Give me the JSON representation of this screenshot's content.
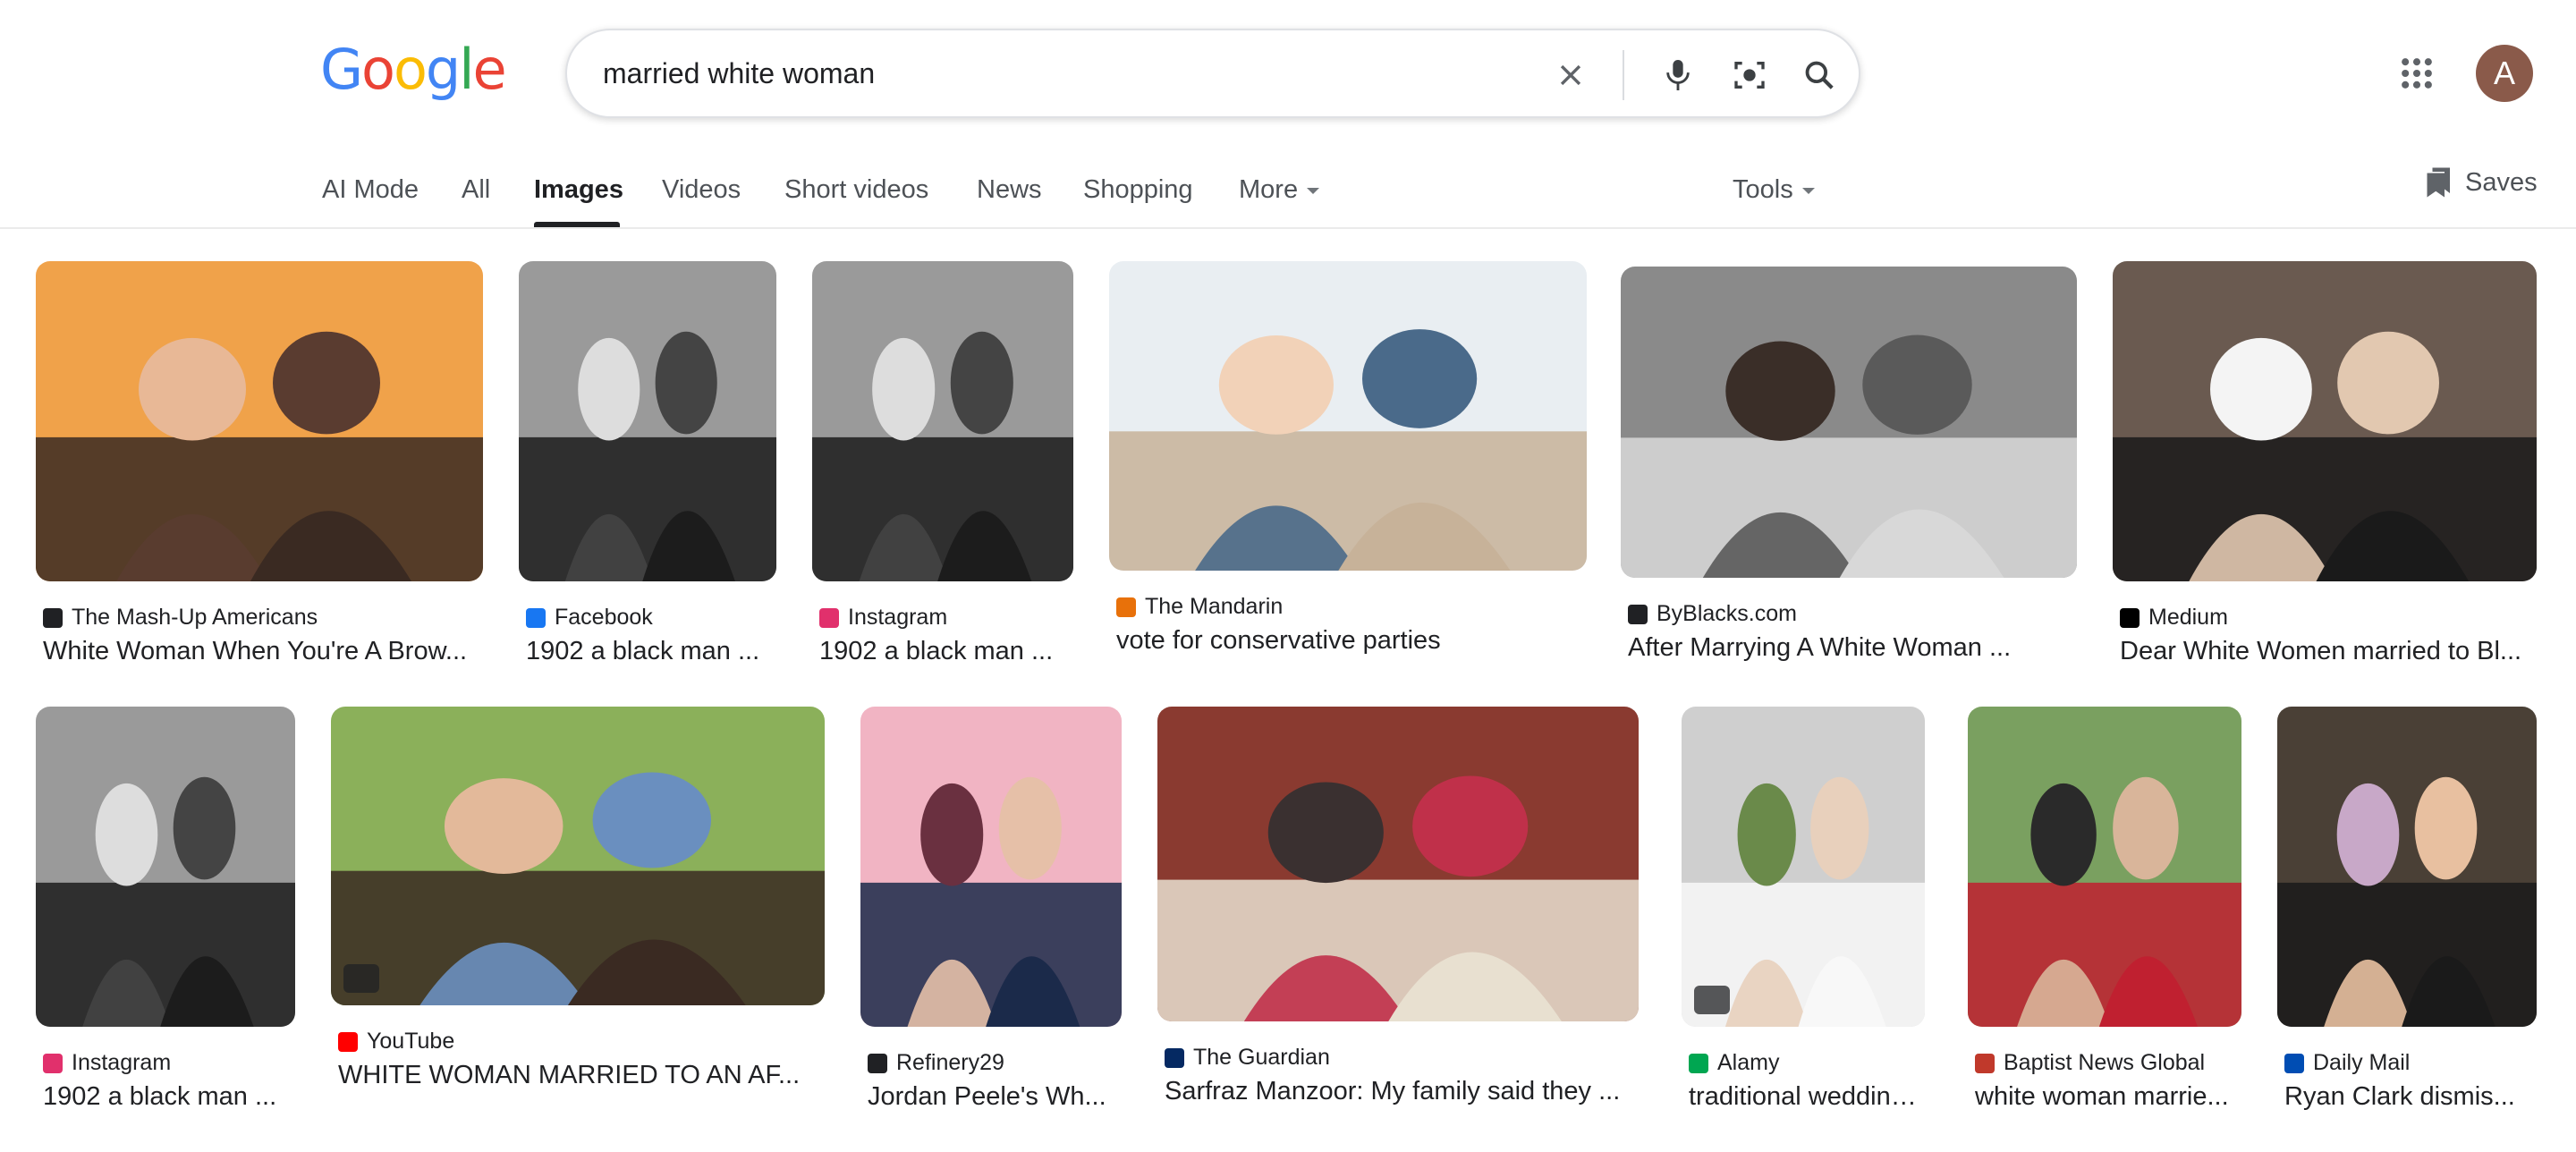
{
  "header": {
    "logo_letters": [
      {
        "ch": "G",
        "color": "#4285f4"
      },
      {
        "ch": "o",
        "color": "#ea4335"
      },
      {
        "ch": "o",
        "color": "#fbbc05"
      },
      {
        "ch": "g",
        "color": "#4285f4"
      },
      {
        "ch": "l",
        "color": "#34a853"
      },
      {
        "ch": "e",
        "color": "#ea4335"
      }
    ],
    "search_query": "married white woman",
    "avatar_letter": "A"
  },
  "nav": {
    "tabs": [
      {
        "label": "AI Mode",
        "active": false
      },
      {
        "label": "All",
        "active": false
      },
      {
        "label": "Images",
        "active": true
      },
      {
        "label": "Videos",
        "active": false
      },
      {
        "label": "Short videos",
        "active": false
      },
      {
        "label": "News",
        "active": false
      },
      {
        "label": "Shopping",
        "active": false
      },
      {
        "label": "More",
        "active": false
      }
    ],
    "tools_label": "Tools",
    "saves_label": "Saves"
  },
  "results": [
    {
      "source": "The Mash-Up Americans",
      "caption": "White Woman When You're A Brow...",
      "favicon_color": "#202124",
      "icon": "mashup-favicon-icon",
      "tone": "warm"
    },
    {
      "source": "Facebook",
      "caption": "1902 a black man ...",
      "favicon_color": "#1877f2",
      "icon": "facebook-icon",
      "tone": "bw"
    },
    {
      "source": "Instagram",
      "caption": "1902 a black man ...",
      "favicon_color": "#e1306c",
      "icon": "instagram-icon",
      "tone": "bw"
    },
    {
      "source": "The Mandarin",
      "caption": "vote for conservative parties",
      "favicon_color": "#e8710a",
      "icon": "mandarin-favicon-icon",
      "tone": "bright"
    },
    {
      "source": "ByBlacks.com",
      "caption": "After Marrying A White Woman ...",
      "favicon_color": "#202124",
      "icon": "byblacks-favicon-icon",
      "tone": "grey"
    },
    {
      "source": "Medium",
      "caption": "Dear White Women married to Bl...",
      "favicon_color": "#000000",
      "icon": "medium-icon",
      "tone": "wedding"
    },
    {
      "source": "Instagram",
      "caption": "1902 a black man ...",
      "favicon_color": "#e1306c",
      "icon": "instagram-icon",
      "tone": "bw"
    },
    {
      "source": "YouTube",
      "caption": "WHITE WOMAN MARRIED TO AN AF...",
      "favicon_color": "#ff0000",
      "icon": "youtube-icon",
      "tone": "garden"
    },
    {
      "source": "Refinery29",
      "caption": "Jordan Peele's Wh...",
      "favicon_color": "#202124",
      "icon": "refinery29-icon",
      "tone": "pink"
    },
    {
      "source": "The Guardian",
      "caption": "Sarfraz Manzoor: My family said they ...",
      "favicon_color": "#052962",
      "icon": "guardian-icon",
      "tone": "hall"
    },
    {
      "source": "Alamy",
      "caption": "traditional wedding...",
      "favicon_color": "#00a651",
      "icon": "alamy-icon",
      "tone": "bride"
    },
    {
      "source": "Baptist News Global",
      "caption": "white woman marrie...",
      "favicon_color": "#c0392b",
      "icon": "baptist-news-icon",
      "tone": "red"
    },
    {
      "source": "Daily Mail",
      "caption": "Ryan Clark dismis...",
      "favicon_color": "#004db3",
      "icon": "daily-mail-icon",
      "tone": "dusk"
    }
  ]
}
